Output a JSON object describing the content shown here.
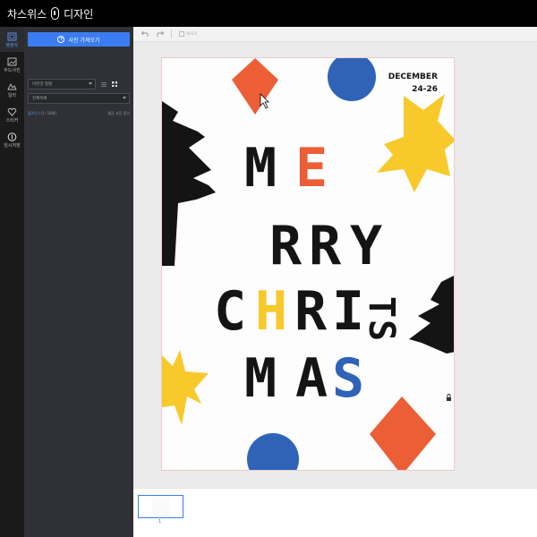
{
  "app": {
    "title_part1": "차스위스",
    "title_part2": "디자인",
    "logo_icon": "phone-outline-icon"
  },
  "rail": {
    "items": [
      {
        "label": "템플릿",
        "icon": "template-icon",
        "active": true
      },
      {
        "label": "두드사진",
        "icon": "photo-icon",
        "active": false
      },
      {
        "label": "일러",
        "icon": "illustration-icon",
        "active": false
      },
      {
        "label": "스티커",
        "icon": "heart-icon",
        "active": false
      },
      {
        "label": "임시저장",
        "icon": "info-circle-icon",
        "active": false
      }
    ]
  },
  "panel": {
    "upload_label": "사진 가져오기",
    "sort_select": "이전것 정렬",
    "folder_select": "전체목록",
    "info_link": "올려진",
    "info_count": "( 0 / 18개)",
    "info_right": "평균 사진 찾기"
  },
  "toolbar": {
    "undo_icon": "undo-icon",
    "redo_icon": "redo-icon",
    "copy_label": "복사기"
  },
  "poster": {
    "date_line1": "DECEMBER",
    "date_line2": "24-26",
    "row1": [
      "M",
      "E"
    ],
    "row2": [
      "R",
      "R",
      "Y"
    ],
    "row3": [
      "C",
      "H",
      "R",
      "I"
    ],
    "row3_rotated": [
      "T",
      "S"
    ],
    "row4": [
      "M",
      "A",
      "S"
    ],
    "colors": {
      "black": "#141414",
      "orange": "#ec5e35",
      "yellow": "#f7c92b",
      "blue": "#2e63b8"
    }
  },
  "strip": {
    "page_number": "1"
  }
}
